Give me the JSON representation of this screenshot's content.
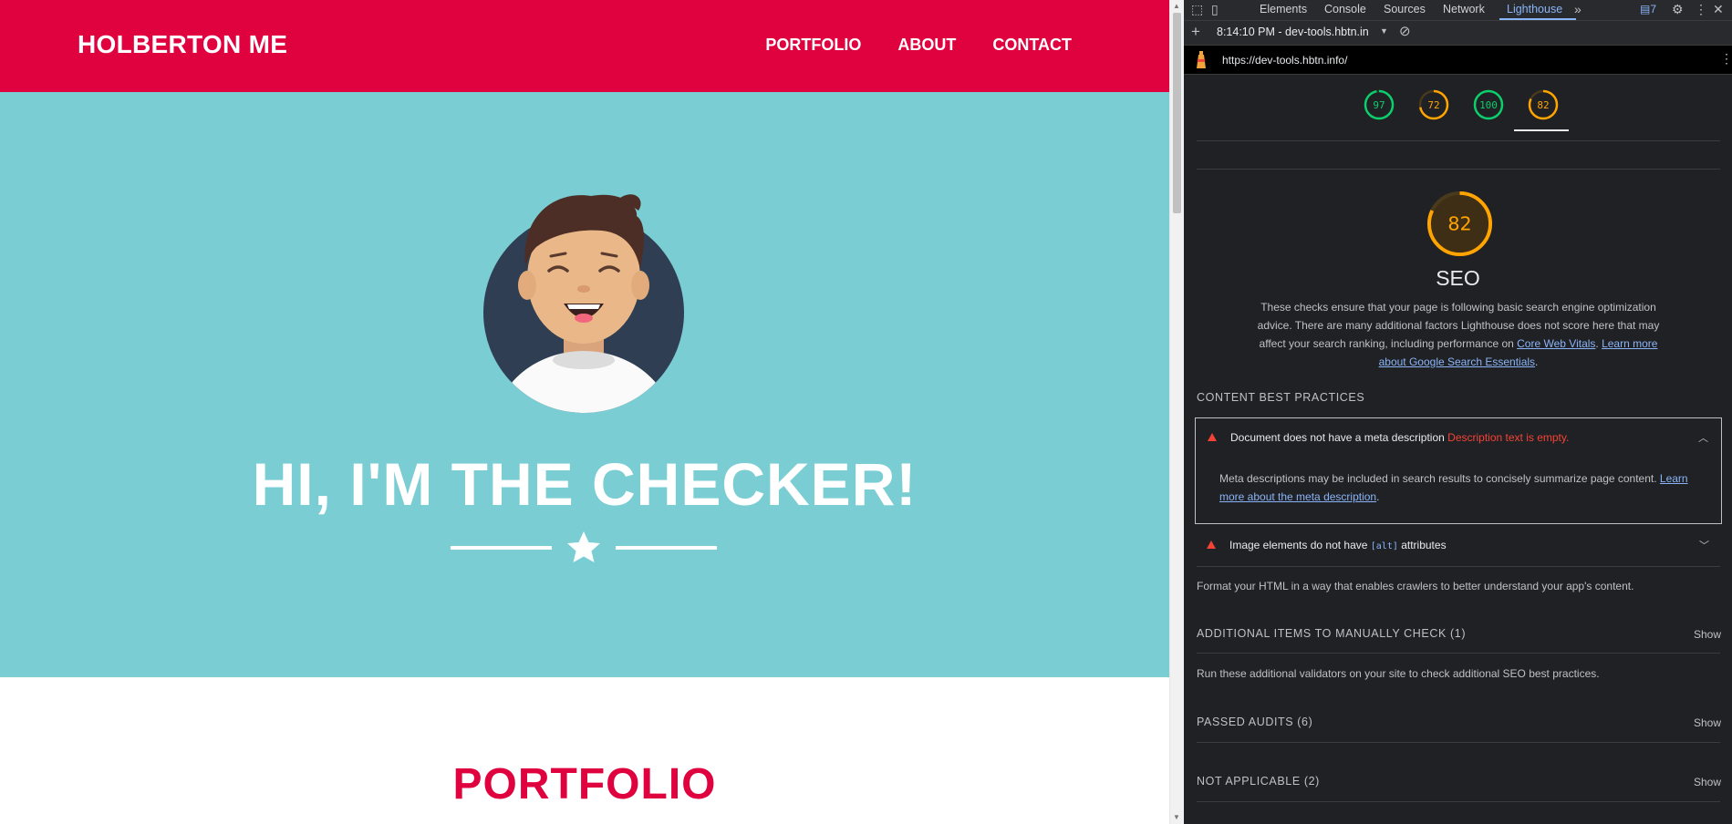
{
  "site": {
    "brand": "HOLBERTON ME",
    "nav": [
      "PORTFOLIO",
      "ABOUT",
      "CONTACT"
    ],
    "hero_title": "HI, I'M THE CHECKER!",
    "section_title": "PORTFOLIO",
    "colors": {
      "primary": "#e0013f",
      "hero_bg": "#7acdd2"
    }
  },
  "devtools": {
    "tabs": [
      "Elements",
      "Console",
      "Sources",
      "Network",
      "Lighthouse"
    ],
    "active_tab": "Lighthouse",
    "issues_count": "7",
    "report_time": "8:14:10 PM - dev-tools.hbtn.in",
    "url": "https://dev-tools.hbtn.info/",
    "scores": [
      "97",
      "72",
      "100",
      "82"
    ],
    "score_fractions": [
      0.97,
      0.72,
      1.0,
      0.82
    ],
    "score_colors": [
      "#0cce6b",
      "#ffa400",
      "#0cce6b",
      "#ffa400"
    ],
    "seo": {
      "score": "82",
      "title": "SEO",
      "description": "These checks ensure that your page is following basic search engine optimization advice. There are many additional factors Lighthouse does not score here that may affect your search ranking, including performance on ",
      "link1": "Core Web Vitals",
      "sep": ". ",
      "link2": "Learn more about Google Search Essentials",
      "end": "."
    },
    "content_best_practices": "CONTENT BEST PRACTICES",
    "audit1": {
      "title": "Document does not have a meta description",
      "fail": "Description text is empty.",
      "body": "Meta descriptions may be included in search results to concisely summarize page content. ",
      "link": "Learn more about the meta description",
      "end": "."
    },
    "audit2": {
      "pre": "Image elements do not have ",
      "code": "[alt]",
      "post": " attributes"
    },
    "format_note": "Format your HTML in a way that enables crawlers to better understand your app's content.",
    "manual_head": "ADDITIONAL ITEMS TO MANUALLY CHECK (1)",
    "manual_note": "Run these additional validators on your site to check additional SEO best practices.",
    "passed_head": "PASSED AUDITS (6)",
    "na_head": "NOT APPLICABLE (2)",
    "show": "Show"
  }
}
